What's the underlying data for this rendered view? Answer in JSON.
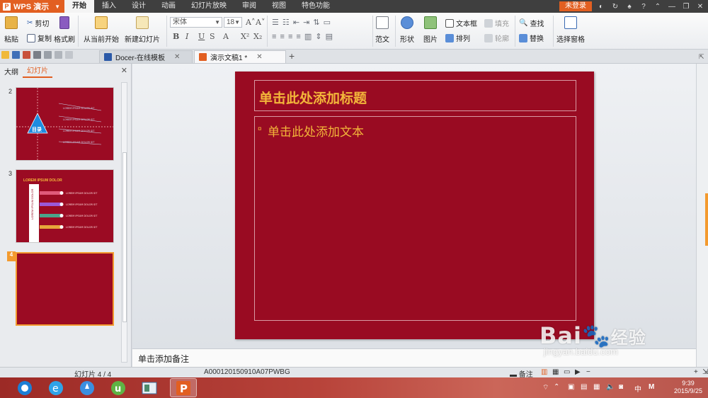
{
  "app": {
    "name": "WPS 演示",
    "login": "未登录"
  },
  "menu": {
    "tabs": [
      "开始",
      "插入",
      "设计",
      "动画",
      "幻灯片放映",
      "审阅",
      "视图",
      "特色功能"
    ]
  },
  "ribbon": {
    "paste": "粘贴",
    "cut": "剪切",
    "copy": "复制",
    "format_painter": "格式刷",
    "from_current": "从当前开始",
    "new_slide": "新建幻灯片",
    "font_name": "宋体",
    "font_size": "18",
    "fanwen": "范文",
    "shape": "形状",
    "picture": "图片",
    "textbox": "文本框",
    "arrange": "排列",
    "fill": "填充",
    "outline": "轮廓",
    "find": "查找",
    "replace": "替换",
    "selection_pane": "选择窗格"
  },
  "tabs": {
    "docer": "Docer-在线模板",
    "doc": "演示文稿1 *"
  },
  "leftpane": {
    "outline": "大纲",
    "slides": "幻灯片"
  },
  "thumbs": {
    "n2": "2",
    "n3": "3",
    "n4": "4",
    "t2_center": "目录",
    "t3_title": "LOREM IPSUM DOLOR",
    "t3_side": "LOREM IPSUM DOLOR"
  },
  "slide": {
    "title": "单击此处添加标题",
    "body": "单击此处添加文本"
  },
  "notes": "单击添加备注",
  "status": {
    "slide_count": "幻灯片 4 / 4",
    "template_id": "A000120150910A07PWBG",
    "notes_btn": "备注"
  },
  "taskbar": {
    "time": "9:39",
    "date": "2015/9/25"
  },
  "watermark": {
    "brand": "Bai",
    "brand2": "经验",
    "url": "jingyan.baidu.com"
  }
}
